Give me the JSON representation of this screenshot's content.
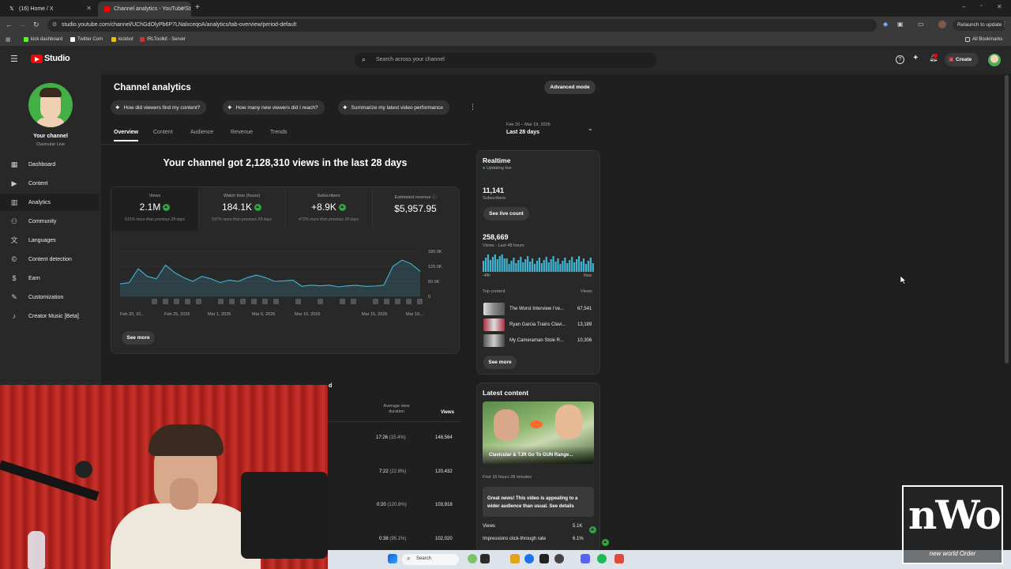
{
  "browser": {
    "tabs": [
      {
        "label": "(16) Home / X",
        "active": false
      },
      {
        "label": "Channel analytics - YouTube St",
        "active": true
      }
    ],
    "url": "studio.youtube.com/channel/UChGdOlyPb6P7LNalxceqoA/analytics/tab-overview/period-default",
    "relaunch_label": "Relaunch to update",
    "bookmarks": [
      "kick dashboard",
      "Twitter Com",
      "kickbot",
      "IRLToolkit - Server"
    ],
    "all_bookmarks": "All Bookmarks"
  },
  "header": {
    "logo_text": "Studio",
    "search_placeholder": "Search across your channel",
    "create_label": "Create"
  },
  "sidebar": {
    "channel_title": "Your channel",
    "channel_name": "Clavicular Live",
    "items": [
      {
        "label": "Dashboard",
        "icon": "dashboard-icon"
      },
      {
        "label": "Content",
        "icon": "content-icon"
      },
      {
        "label": "Analytics",
        "icon": "analytics-icon"
      },
      {
        "label": "Community",
        "icon": "community-icon"
      },
      {
        "label": "Languages",
        "icon": "languages-icon"
      },
      {
        "label": "Content detection",
        "icon": "copyright-icon"
      },
      {
        "label": "Earn",
        "icon": "earn-icon"
      },
      {
        "label": "Customization",
        "icon": "customization-icon"
      },
      {
        "label": "Creator Music [Beta]",
        "icon": "music-icon"
      }
    ]
  },
  "page": {
    "title": "Channel analytics",
    "advanced_mode": "Advanced mode",
    "chips": [
      "How did viewers find my content?",
      "How many new viewers did I reach?",
      "Summarize my latest video performance"
    ],
    "tabs": [
      "Overview",
      "Content",
      "Audience",
      "Revenue",
      "Trends"
    ],
    "date_range": "Feb 20 – Mar 19, 2026",
    "period": "Last 28 days"
  },
  "overview": {
    "headline": "Your channel got 2,128,310 views in the last 28 days",
    "metrics": [
      {
        "label": "Views",
        "value": "2.1M",
        "sub": "631% more than previous 28 days",
        "up": true
      },
      {
        "label": "Watch time (hours)",
        "value": "184.1K",
        "sub": "537% more than previous 28 days",
        "up": true
      },
      {
        "label": "Subscribers",
        "value": "+8.9K",
        "sub": "472% more than previous 28 days",
        "up": true
      },
      {
        "label": "Estimated revenue",
        "value": "$5,957.95",
        "sub": "",
        "up": false
      }
    ],
    "see_more": "See more"
  },
  "chart_data": {
    "type": "area",
    "x_tick_labels": [
      "Feb 20, 20...",
      "Feb 25, 2026",
      "Mar 1, 2026",
      "Mar 6, 2026",
      "Mar 10, 2026",
      "Mar 15, 2026",
      "Mar 19,..."
    ],
    "y_tick_labels": [
      "180.0K",
      "120.0K",
      "60.0K",
      "0"
    ],
    "ylim": [
      0,
      180000
    ],
    "values": [
      50000,
      55000,
      110000,
      80000,
      70000,
      125000,
      95000,
      75000,
      60000,
      80000,
      70000,
      55000,
      65000,
      60000,
      75000,
      85000,
      75000,
      60000,
      62000,
      65000,
      40000,
      45000,
      42000,
      45000,
      38000,
      42000,
      44000,
      40000,
      41000,
      45000,
      120000,
      145000,
      130000,
      100000
    ],
    "grid": true
  },
  "realtime": {
    "title": "Realtime",
    "status": "Updating live",
    "subscribers_value": "11,141",
    "subscribers_label": "Subscribers",
    "see_live_count": "See live count",
    "views_value": "258,669",
    "views_label": "Views · Last 48 hours",
    "axis_left": "-48h",
    "axis_right": "Now",
    "top_content_label": "Top content",
    "views_col_label": "Views",
    "top_content": [
      {
        "title": "The Worst Interview I've...",
        "views": "67,541"
      },
      {
        "title": "Ryan Garcia Trains Clavi...",
        "views": "13,189"
      },
      {
        "title": "My Cameraman Stole R...",
        "views": "10,306"
      }
    ],
    "see_more": "See more"
  },
  "latest_content": {
    "title": "Latest content",
    "video_title": "Clavicular & TJR Go To GUN Range...",
    "time_label": "First 16 hours 28 minutes",
    "insight": "Great news! This video is appealing to a wider audience than usual. See details",
    "stats": [
      {
        "label": "Views",
        "value": "5.1K"
      },
      {
        "label": "Impressions click-through rate",
        "value": "6.1%"
      }
    ]
  },
  "top_videos": {
    "col_avg": "Average view duration",
    "col_views": "Views",
    "rows": [
      {
        "avg": "17:26",
        "pct": "(15.4%)",
        "views": "148,564"
      },
      {
        "avg": "7:22",
        "pct": "(22.8%)",
        "views": "120,432"
      },
      {
        "avg": "0:20",
        "pct": "(120.8%)",
        "views": "103,918"
      },
      {
        "avg": "0:38",
        "pct": "(95.1%)",
        "views": "102,020"
      }
    ]
  },
  "taskbar": {
    "search_label": "Search"
  },
  "watermark": {
    "text": "nWo",
    "sub": "new world Order"
  },
  "colors": {
    "accent_red": "#ff0000",
    "chart_line": "#41b4d2",
    "up_green": "#2ba640"
  }
}
